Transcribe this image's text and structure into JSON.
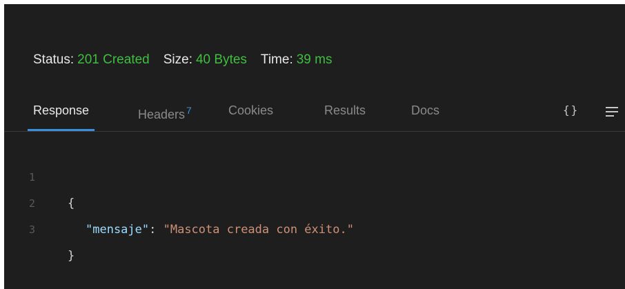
{
  "status": {
    "status_label": "Status:",
    "status_value": "201 Created",
    "size_label": "Size:",
    "size_value": "40 Bytes",
    "time_label": "Time:",
    "time_value": "39 ms"
  },
  "tabs": [
    {
      "label": "Response",
      "active": true
    },
    {
      "label": "Headers",
      "badge": "7"
    },
    {
      "label": "Cookies"
    },
    {
      "label": "Results"
    },
    {
      "label": "Docs"
    }
  ],
  "toolbar": {
    "braces_label": "{}",
    "braces_icon": "braces-icon",
    "menu_icon": "menu-icon"
  },
  "code": {
    "lines": [
      {
        "number": "1",
        "open": "{"
      },
      {
        "number": "2",
        "key": "\"mensaje\"",
        "sep": ": ",
        "value": "\"Mascota creada con éxito.\""
      },
      {
        "number": "3",
        "close": "}"
      }
    ]
  },
  "colors": {
    "background": "#1e1e1e",
    "status_value": "#3fbf3f",
    "accent": "#3b8edb",
    "json_key": "#9cdcfe",
    "json_string": "#ce9178"
  }
}
